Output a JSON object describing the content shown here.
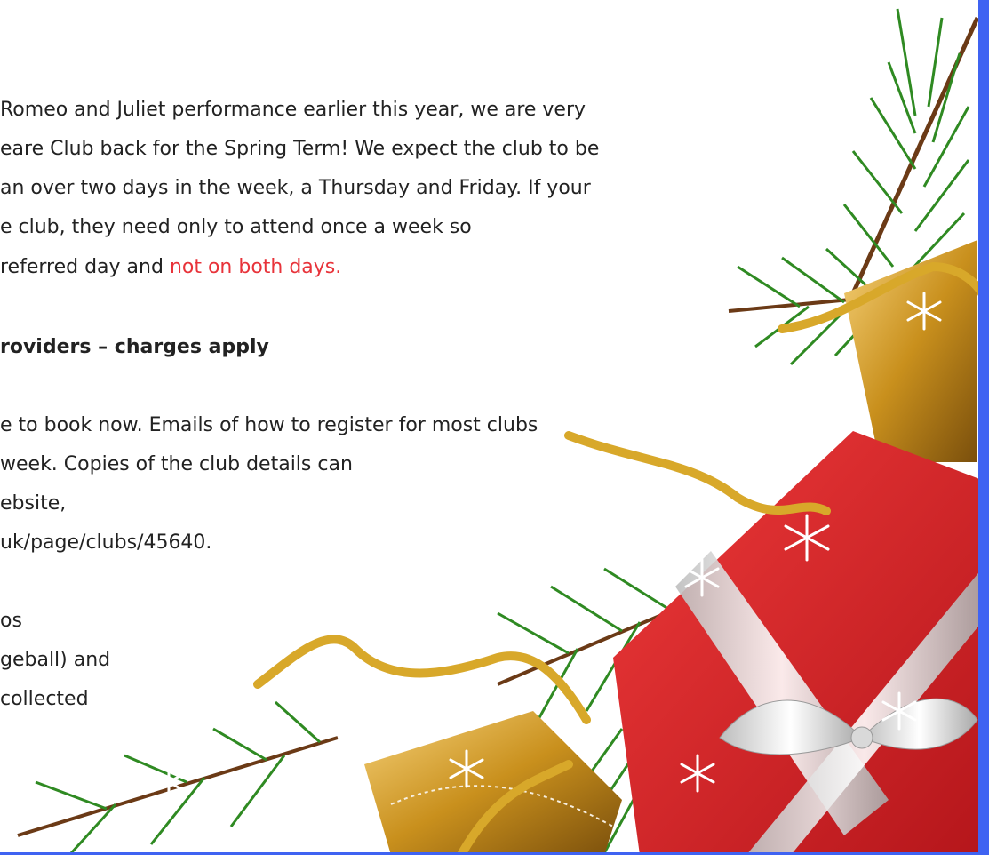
{
  "paragraph1": {
    "line1": "Romeo and Juliet performance earlier this year, we are very",
    "line2": "eare Club back for the Spring Term! We expect the club to be",
    "line3": "an over two days in the week, a Thursday and Friday. If your",
    "line4": "e club, they need only to attend once a week so",
    "line5_a": "referred day and ",
    "line5_b": "not on both days."
  },
  "heading": "roviders – charges apply",
  "paragraph2": {
    "line1": "e to book now. Emails of how to register for most clubs",
    "line2": "week. Copies of the club details can",
    "line3": "ebsite,",
    "line4": "uk/page/clubs/45640."
  },
  "paragraph3": {
    "line1": "os",
    "line2": "geball) and",
    "line3": "collected"
  },
  "colors": {
    "accent_red": "#e8333a",
    "border_blue": "#3f63f2",
    "pine_green": "#2f8a22",
    "gift_red": "#d6262b",
    "ribbon_gold": "#d8a82a"
  },
  "icons": [
    "pine-branch-icon",
    "gift-box-icon",
    "ribbon-icon",
    "snowflake-icon",
    "bow-icon"
  ]
}
